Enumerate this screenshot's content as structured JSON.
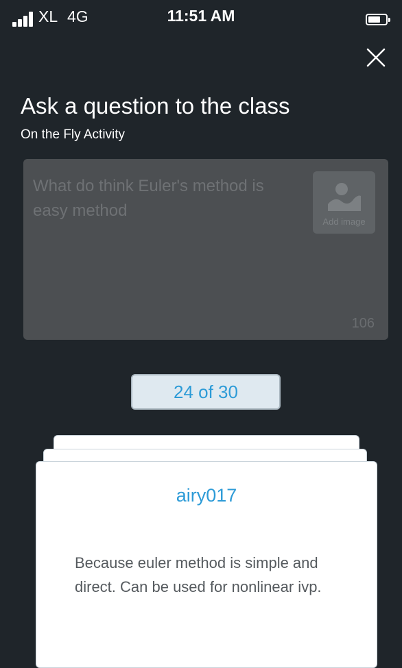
{
  "status_bar": {
    "carrier": "XL",
    "network": "4G",
    "time": "11:51 AM"
  },
  "header": {
    "title": "Ask a question to the class",
    "subtitle": "On the Fly Activity"
  },
  "question": {
    "text": "What do think Euler's method is easy method",
    "add_image_label": "Add image",
    "char_count": "106"
  },
  "counter": {
    "text": "24 of 30"
  },
  "response": {
    "author": "airy017",
    "text": "Because euler method is simple and direct. Can be used for nonlinear ivp."
  },
  "colors": {
    "background": "#1f252a",
    "accent": "#2d9bd7",
    "card": "#ffffff"
  }
}
